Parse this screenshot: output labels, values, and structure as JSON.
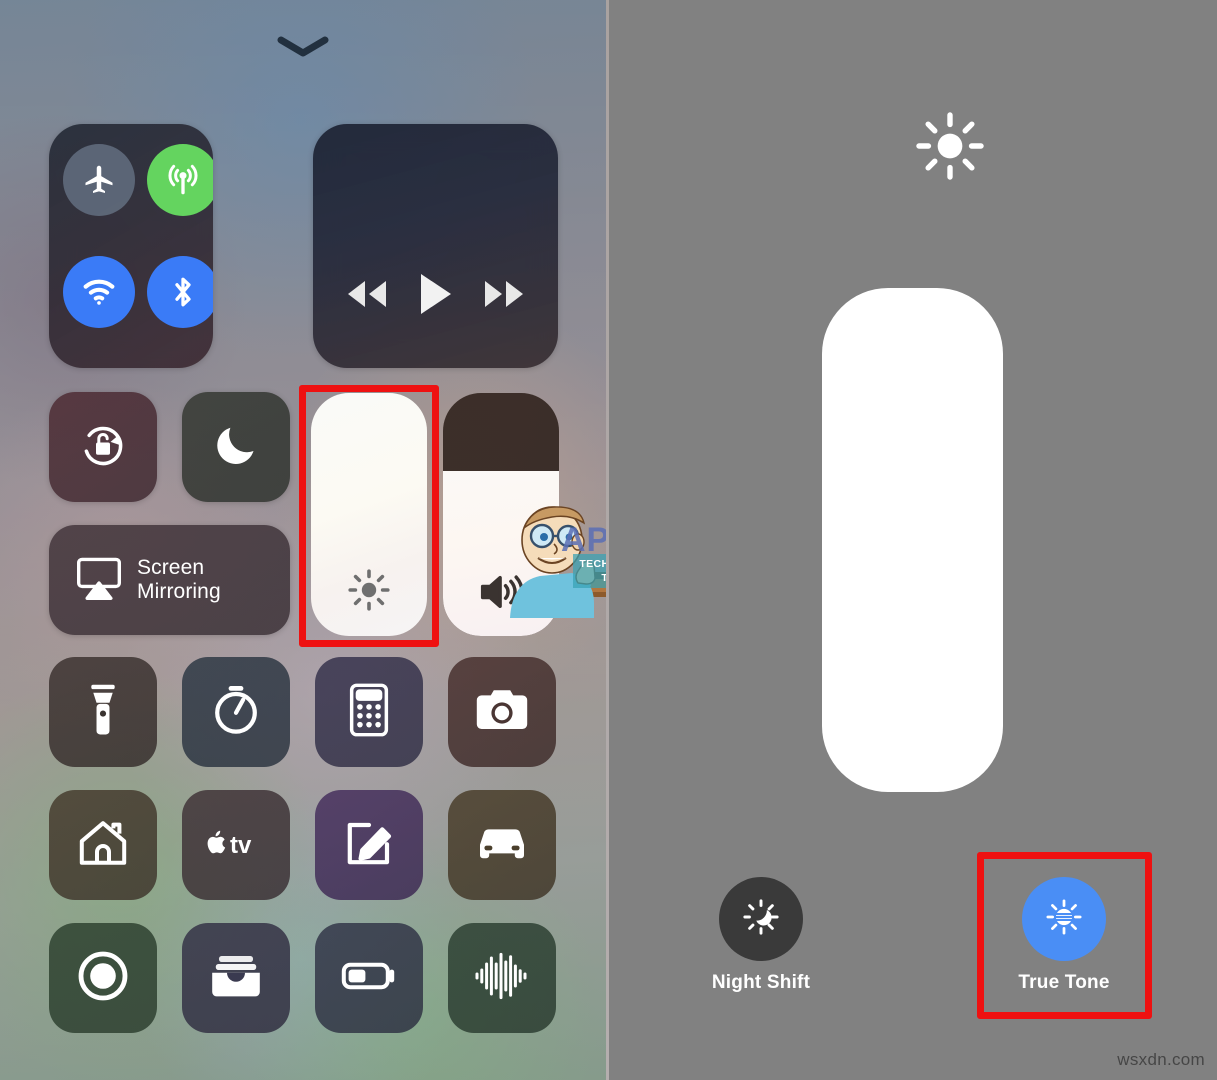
{
  "left_panel": {
    "name": "iOS Control Center",
    "grabber_icon": "chevron-down-icon",
    "connectivity": {
      "buttons": [
        {
          "name": "airplane-mode",
          "icon": "airplane-icon",
          "state": "off",
          "color": "#687686"
        },
        {
          "name": "cellular-data",
          "icon": "cellular-antenna-icon",
          "state": "on",
          "color": "#64d45f"
        },
        {
          "name": "wifi",
          "icon": "wifi-icon",
          "state": "on",
          "color": "#3a7bf7"
        },
        {
          "name": "bluetooth",
          "icon": "bluetooth-icon",
          "state": "on",
          "color": "#3a7bf7"
        }
      ]
    },
    "media": {
      "buttons": [
        {
          "name": "rewind",
          "icon": "rewind-icon"
        },
        {
          "name": "play",
          "icon": "play-icon"
        },
        {
          "name": "fast-forward",
          "icon": "fast-forward-icon"
        }
      ]
    },
    "toggles": [
      {
        "name": "rotation-lock",
        "icon": "rotation-lock-icon",
        "state": "off"
      },
      {
        "name": "do-not-disturb",
        "icon": "moon-icon",
        "state": "off"
      }
    ],
    "screen_mirroring": {
      "icon": "airplay-icon",
      "label_line1": "Screen",
      "label_line2": "Mirroring"
    },
    "sliders": [
      {
        "name": "brightness-slider",
        "icon": "sun-icon",
        "value_percent": 100,
        "highlighted": true
      },
      {
        "name": "volume-slider",
        "icon": "speaker-icon",
        "value_percent": 68,
        "highlighted": false
      }
    ],
    "app_grid": [
      {
        "name": "flashlight",
        "icon": "flashlight-icon"
      },
      {
        "name": "timer",
        "icon": "timer-icon"
      },
      {
        "name": "calculator",
        "icon": "calculator-icon"
      },
      {
        "name": "camera",
        "icon": "camera-icon"
      },
      {
        "name": "home",
        "icon": "home-icon"
      },
      {
        "name": "apple-tv-remote",
        "icon": "apple-tv-icon",
        "label": "tv"
      },
      {
        "name": "notes",
        "icon": "notes-pencil-icon"
      },
      {
        "name": "do-not-disturb-while-driving",
        "icon": "car-icon"
      },
      {
        "name": "screen-recording",
        "icon": "record-icon"
      },
      {
        "name": "wallet",
        "icon": "wallet-icon"
      },
      {
        "name": "low-power-mode",
        "icon": "battery-icon"
      },
      {
        "name": "hearing",
        "icon": "sound-wave-icon"
      }
    ]
  },
  "right_panel": {
    "name": "Brightness Expanded View",
    "header_icon": "sun-icon",
    "slider": {
      "name": "brightness-slider-expanded",
      "value_percent": 100
    },
    "controls": [
      {
        "name": "night-shift",
        "icon": "sun-moon-icon",
        "label": "Night Shift",
        "state": "off",
        "color": "#3a3a3a"
      },
      {
        "name": "true-tone",
        "icon": "true-tone-sun-icon",
        "label": "True Tone",
        "state": "on",
        "color": "#4a8ef5",
        "highlighted": true
      }
    ]
  },
  "annotations": {
    "highlight_color": "#ee1111",
    "boxes": [
      {
        "name": "brightness-slider-highlight",
        "target": "brightness-slider"
      },
      {
        "name": "true-tone-highlight",
        "target": "true-tone"
      }
    ]
  },
  "watermarks": {
    "brand": "APPUALS",
    "tagline_line1": "TECH HOW-TO'S FROM",
    "tagline_line2": "THE EXPERTS!",
    "site": "wsxdn.com"
  }
}
